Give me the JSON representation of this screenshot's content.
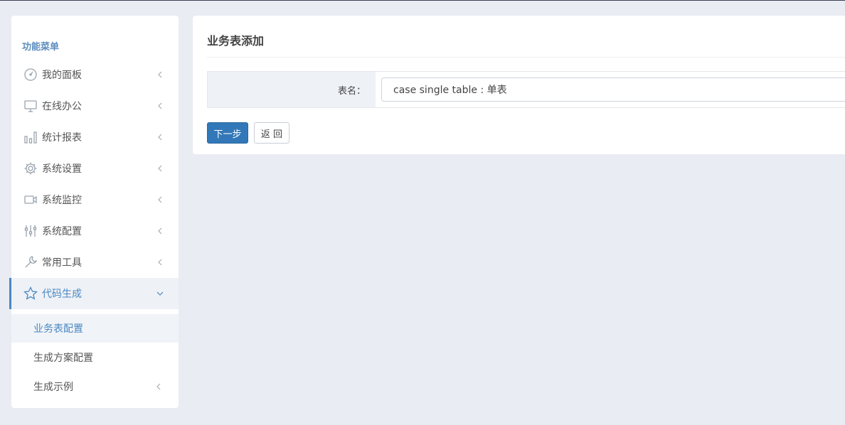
{
  "sidebar": {
    "title": "功能菜单",
    "items": [
      {
        "label": "我的面板",
        "icon": "dashboard-icon"
      },
      {
        "label": "在线办公",
        "icon": "monitor-icon"
      },
      {
        "label": "统计报表",
        "icon": "bar-chart-icon"
      },
      {
        "label": "系统设置",
        "icon": "gear-icon"
      },
      {
        "label": "系统监控",
        "icon": "video-camera-icon"
      },
      {
        "label": "系统配置",
        "icon": "sliders-icon"
      },
      {
        "label": "常用工具",
        "icon": "wrench-icon"
      },
      {
        "label": "代码生成",
        "icon": "star-icon",
        "expanded": true
      }
    ],
    "subitems": [
      {
        "label": "业务表配置",
        "selected": true
      },
      {
        "label": "生成方案配置"
      },
      {
        "label": "生成示例"
      }
    ]
  },
  "panel": {
    "title": "业务表添加",
    "form": {
      "label": "表名：",
      "value": "case single table : 单表"
    },
    "buttons": {
      "next": "下一步",
      "back": "返 回"
    }
  },
  "colors": {
    "accent": "#3278b8",
    "active_text": "#4a88c3",
    "background": "#e9ecf3"
  }
}
